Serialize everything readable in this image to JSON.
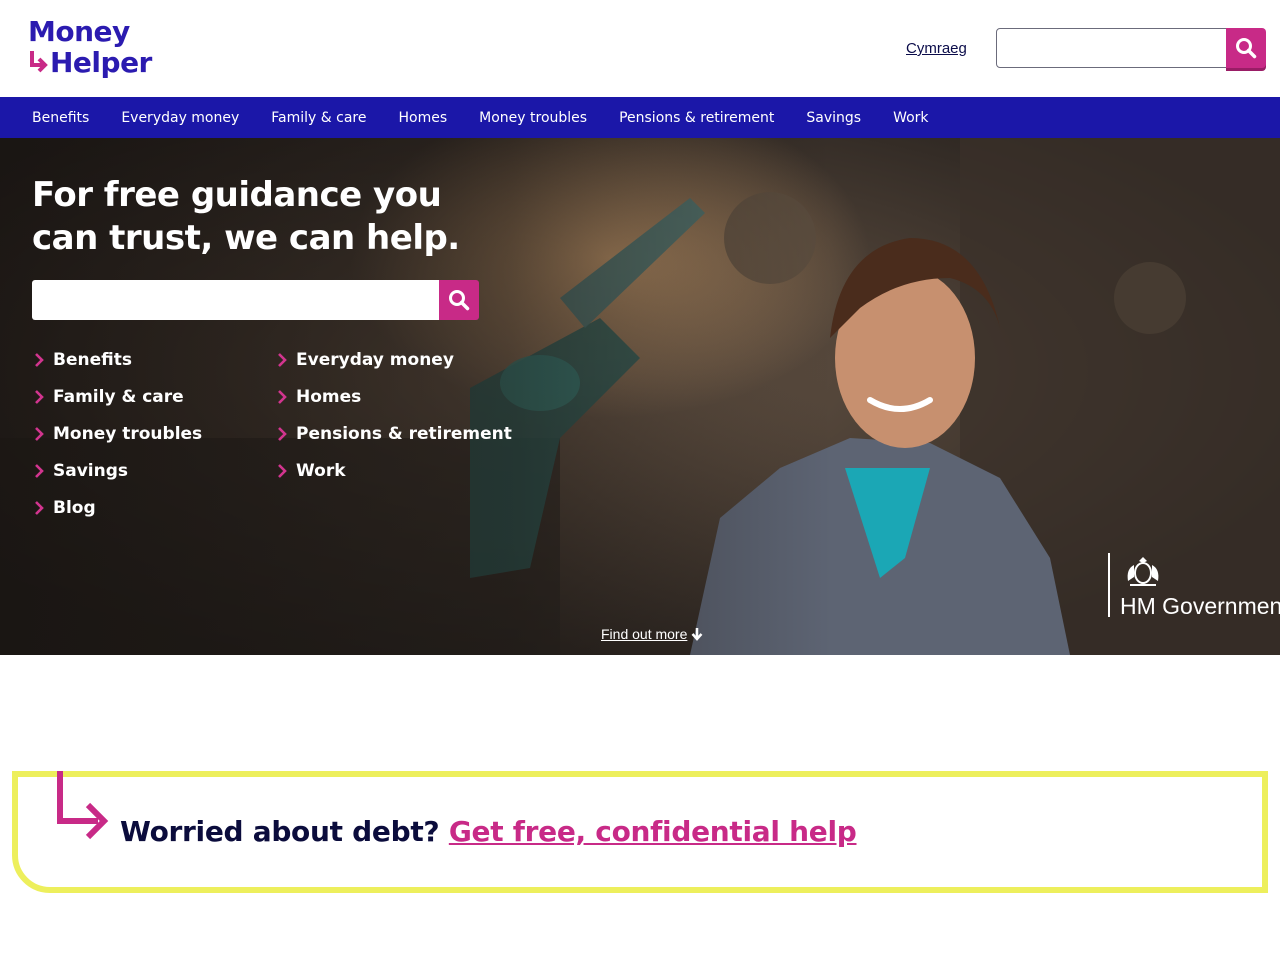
{
  "brand": {
    "logo_line1": "Money",
    "logo_line2": "Helper",
    "primary_color": "#1b17a8",
    "accent_color": "#c82a87",
    "highlight_color": "#edef5c"
  },
  "header": {
    "language_link": "Cymraeg",
    "search": {
      "placeholder": "",
      "button_icon": "search-icon"
    }
  },
  "nav": {
    "items": [
      {
        "label": "Benefits"
      },
      {
        "label": "Everyday money"
      },
      {
        "label": "Family & care"
      },
      {
        "label": "Homes"
      },
      {
        "label": "Money troubles"
      },
      {
        "label": "Pensions & retirement"
      },
      {
        "label": "Savings"
      },
      {
        "label": "Work"
      }
    ]
  },
  "hero": {
    "title": "For free guidance you can trust, we can help.",
    "search": {
      "placeholder": "",
      "button_icon": "search-icon"
    },
    "links": [
      {
        "label": "Benefits"
      },
      {
        "label": "Everyday money"
      },
      {
        "label": "Family & care"
      },
      {
        "label": "Homes"
      },
      {
        "label": "Money troubles"
      },
      {
        "label": "Pensions & retirement"
      },
      {
        "label": "Savings"
      },
      {
        "label": "Work"
      },
      {
        "label": "Blog"
      }
    ],
    "find_more": "Find out more",
    "government_label": "HM Government"
  },
  "callout": {
    "question": "Worried about debt?",
    "link_text": "Get free, confidential help"
  }
}
